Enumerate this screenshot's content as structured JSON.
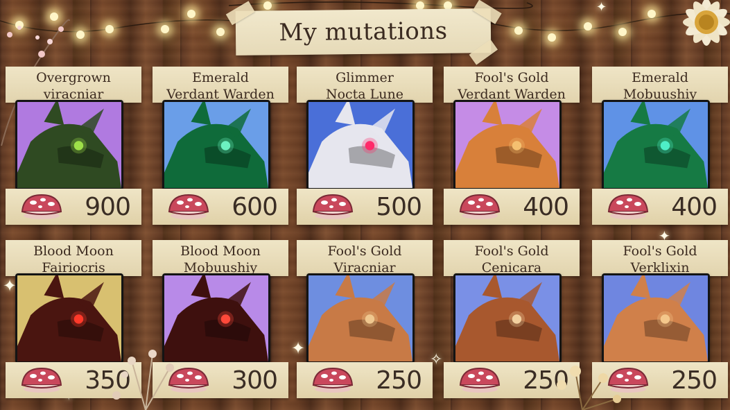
{
  "title": "My mutations",
  "currency_icon": "mushroom-icon",
  "colors": {
    "paper": "#efe5c6",
    "mushroom_red": "#c9485c",
    "text": "#3a2a20"
  },
  "cards": [
    {
      "name_line1": "Overgrown",
      "name_line2": "viracniar",
      "price": "900",
      "bg": "#b07ae0",
      "body": "#2f4a22",
      "eye": "#9ee04a"
    },
    {
      "name_line1": "Emerald",
      "name_line2": "Verdant Warden",
      "price": "600",
      "bg": "#6a9ee8",
      "body": "#0f6b3a",
      "eye": "#6cf2c0"
    },
    {
      "name_line1": "Glimmer",
      "name_line2": "Nocta Lune",
      "price": "500",
      "bg": "#4a6fd8",
      "body": "#e6e6ee",
      "eye": "#ff2a6a"
    },
    {
      "name_line1": "Fool's Gold",
      "name_line2": "Verdant Warden",
      "price": "400",
      "bg": "#c58ce6",
      "body": "#d8803a",
      "eye": "#f4c070"
    },
    {
      "name_line1": "Emerald",
      "name_line2": "Mobuushiy",
      "price": "400",
      "bg": "#5f92e6",
      "body": "#167a44",
      "eye": "#4ef0c8"
    },
    {
      "name_line1": "Blood Moon",
      "name_line2": "Fairiocris",
      "price": "350",
      "bg": "#d8c070",
      "body": "#4a1510",
      "eye": "#ff3a2a"
    },
    {
      "name_line1": "Blood Moon",
      "name_line2": "Mobuushiy",
      "price": "300",
      "bg": "#b88ae8",
      "body": "#3e100e",
      "eye": "#ff4a3a"
    },
    {
      "name_line1": "Fool's Gold",
      "name_line2": "Viracniar",
      "price": "250",
      "bg": "#6e8ee0",
      "body": "#c87a46",
      "eye": "#f0c890"
    },
    {
      "name_line1": "Fool's Gold",
      "name_line2": "Cenicara",
      "price": "250",
      "bg": "#7a90e6",
      "body": "#a8582e",
      "eye": "#f2d0a0"
    },
    {
      "name_line1": "Fool's Gold",
      "name_line2": "Verklixin",
      "price": "250",
      "bg": "#6f86e0",
      "body": "#d0804a",
      "eye": "#f4c88c"
    }
  ]
}
